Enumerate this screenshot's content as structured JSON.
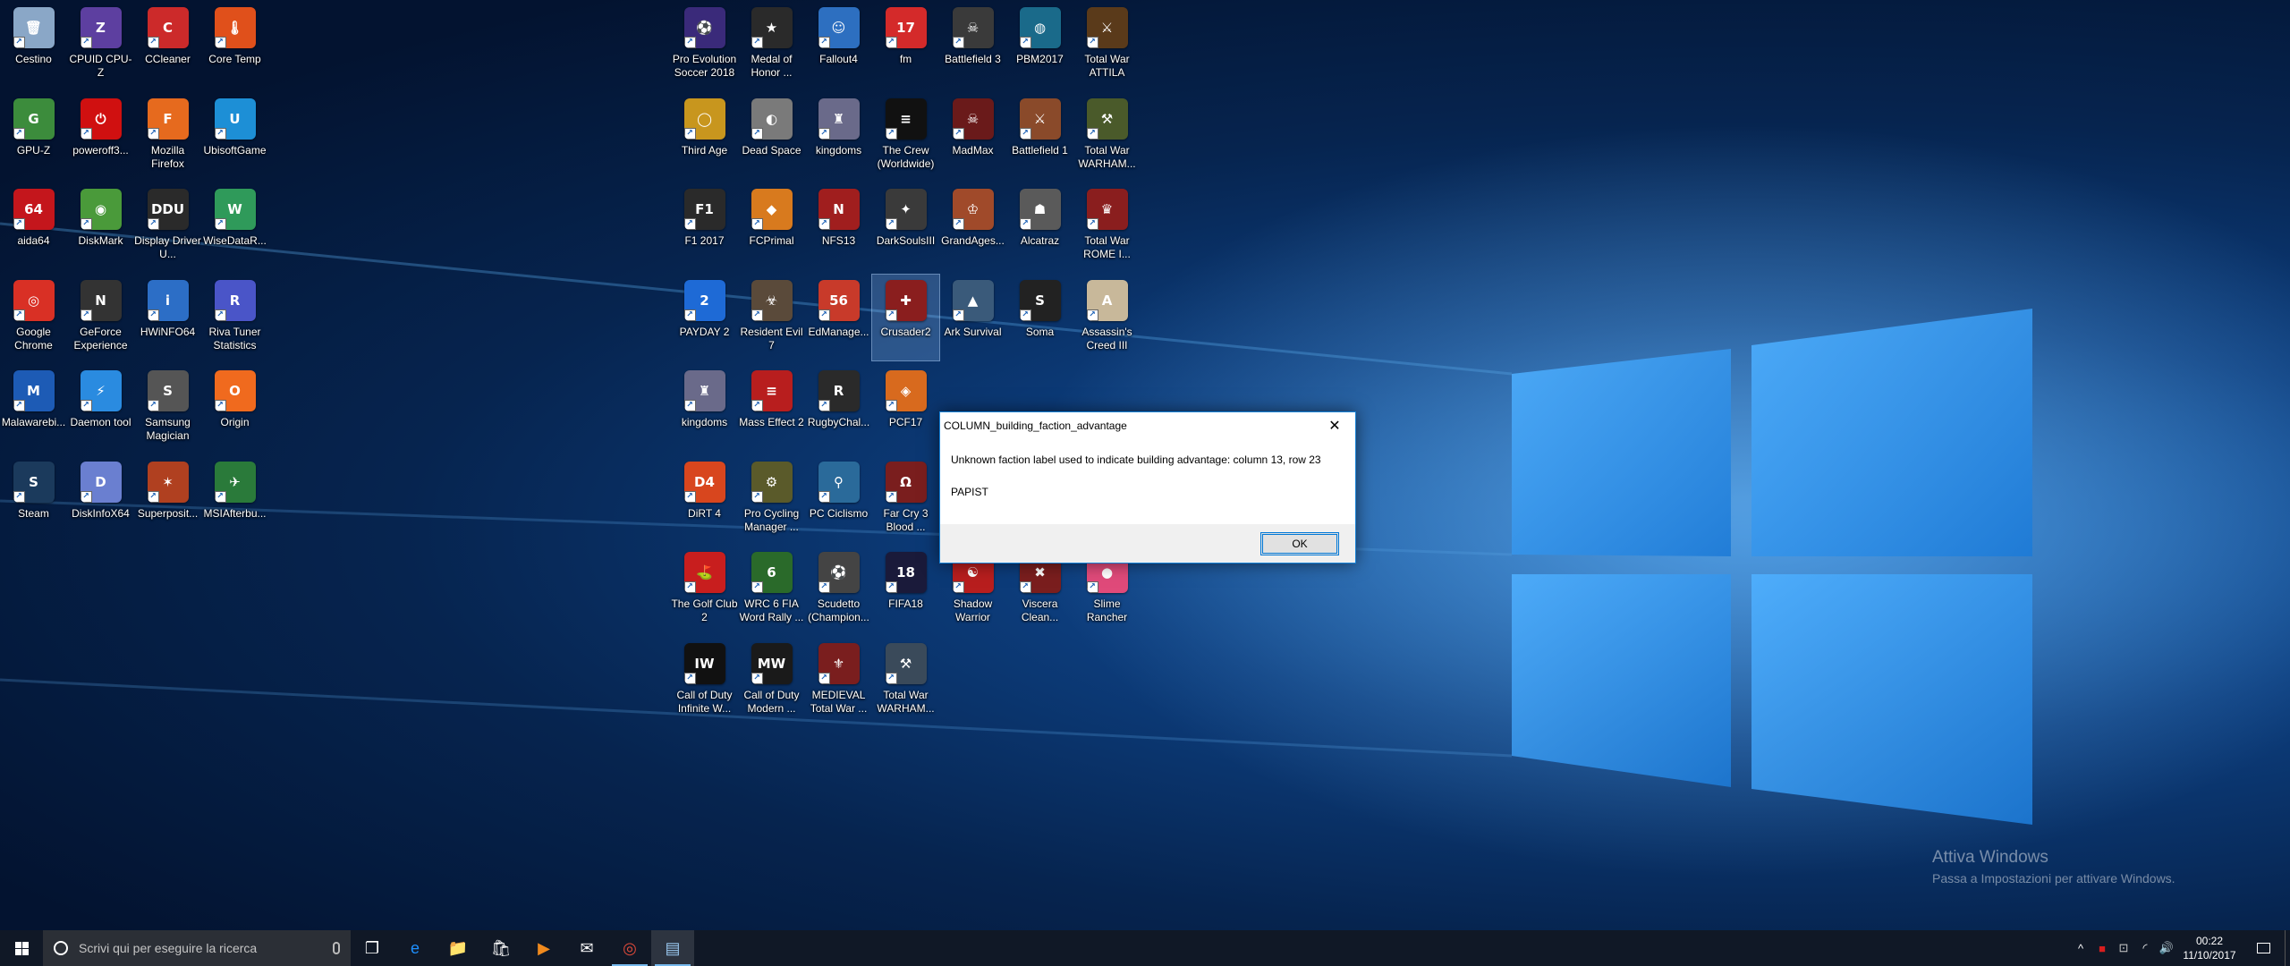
{
  "desktop_icons": [
    {
      "label": "Cestino",
      "icon": "recycle-bin-icon",
      "color": "#8aa7c7",
      "glyph": "🗑",
      "col": 0,
      "row": 0
    },
    {
      "label": "CPUID CPU-Z",
      "icon": "cpuz-icon",
      "color": "#5d3fa0",
      "glyph": "Z",
      "col": 1,
      "row": 0
    },
    {
      "label": "CCleaner",
      "icon": "ccleaner-icon",
      "color": "#cc2a2a",
      "glyph": "C",
      "col": 2,
      "row": 0
    },
    {
      "label": "Core Temp",
      "icon": "core-temp-icon",
      "color": "#e0501b",
      "glyph": "🌡",
      "col": 3,
      "row": 0
    },
    {
      "label": "GPU-Z",
      "icon": "gpuz-icon",
      "color": "#3c8c3c",
      "glyph": "G",
      "col": 0,
      "row": 1
    },
    {
      "label": "poweroff3...",
      "icon": "poweroff-icon",
      "color": "#d01010",
      "glyph": "⏻",
      "col": 1,
      "row": 1
    },
    {
      "label": "Mozilla Firefox",
      "icon": "firefox-icon",
      "color": "#e66a1e",
      "glyph": "F",
      "col": 2,
      "row": 1
    },
    {
      "label": "UbisoftGame",
      "icon": "ubisoft-icon",
      "color": "#1d8fd6",
      "glyph": "U",
      "col": 3,
      "row": 1
    },
    {
      "label": "aida64",
      "icon": "aida64-icon",
      "color": "#c4161c",
      "glyph": "64",
      "col": 0,
      "row": 2
    },
    {
      "label": "DiskMark",
      "icon": "diskmark-icon",
      "color": "#4a9a3a",
      "glyph": "◉",
      "col": 1,
      "row": 2
    },
    {
      "label": "Display Driver U...",
      "icon": "ddu-icon",
      "color": "#2a2a2a",
      "glyph": "DDU",
      "col": 2,
      "row": 2
    },
    {
      "label": "WiseDataR...",
      "icon": "wisedata-icon",
      "color": "#2f9a5a",
      "glyph": "W",
      "col": 3,
      "row": 2
    },
    {
      "label": "Google Chrome",
      "icon": "chrome-icon",
      "color": "#d93025",
      "glyph": "◎",
      "col": 0,
      "row": 3
    },
    {
      "label": "GeForce Experience",
      "icon": "geforce-icon",
      "color": "#333333",
      "glyph": "N",
      "col": 1,
      "row": 3
    },
    {
      "label": "HWiNFO64",
      "icon": "hwinfo-icon",
      "color": "#2c6ec6",
      "glyph": "i",
      "col": 2,
      "row": 3
    },
    {
      "label": "Riva Tuner Statistics",
      "icon": "rivatuner-icon",
      "color": "#4a55c8",
      "glyph": "R",
      "col": 3,
      "row": 3
    },
    {
      "label": "Malawarebi...",
      "icon": "malwarebytes-icon",
      "color": "#1d5bb5",
      "glyph": "M",
      "col": 0,
      "row": 4
    },
    {
      "label": "Daemon tool",
      "icon": "daemon-tools-icon",
      "color": "#2a8be0",
      "glyph": "⚡",
      "col": 1,
      "row": 4
    },
    {
      "label": "Samsung Magician",
      "icon": "samsung-magician-icon",
      "color": "#555555",
      "glyph": "S",
      "col": 2,
      "row": 4
    },
    {
      "label": "Origin",
      "icon": "origin-icon",
      "color": "#f06a1e",
      "glyph": "O",
      "col": 3,
      "row": 4
    },
    {
      "label": "Steam",
      "icon": "steam-icon",
      "color": "#1b3a5c",
      "glyph": "S",
      "col": 0,
      "row": 5
    },
    {
      "label": "DiskInfoX64",
      "icon": "diskinfo-icon",
      "color": "#6a7fd0",
      "glyph": "D",
      "col": 1,
      "row": 5
    },
    {
      "label": "Superposit...",
      "icon": "superposition-icon",
      "color": "#b04020",
      "glyph": "✶",
      "col": 2,
      "row": 5
    },
    {
      "label": "MSIAfterbu...",
      "icon": "msi-afterburner-icon",
      "color": "#2a7a3a",
      "glyph": "✈",
      "col": 3,
      "row": 5
    },
    {
      "label": "Pro Evolution Soccer 2018",
      "icon": "pes2018-icon",
      "color": "#3a2a7a",
      "glyph": "⚽",
      "col": 10,
      "row": 0
    },
    {
      "label": "Medal of Honor ...",
      "icon": "medal-of-honor-icon",
      "color": "#2a2a2a",
      "glyph": "★",
      "col": 11,
      "row": 0
    },
    {
      "label": "Fallout4",
      "icon": "fallout4-icon",
      "color": "#2d6fc0",
      "glyph": "☺",
      "col": 12,
      "row": 0
    },
    {
      "label": "fm",
      "icon": "football-manager-icon",
      "color": "#d42a2a",
      "glyph": "17",
      "col": 13,
      "row": 0
    },
    {
      "label": "Battlefield 3",
      "icon": "battlefield3-icon",
      "color": "#3a3a3a",
      "glyph": "☠",
      "col": 14,
      "row": 0
    },
    {
      "label": "PBM2017",
      "icon": "pbm2017-icon",
      "color": "#1a6a8a",
      "glyph": "◍",
      "col": 15,
      "row": 0
    },
    {
      "label": "Total War ATTILA",
      "icon": "attila-icon",
      "color": "#5a3a1a",
      "glyph": "⚔",
      "col": 16,
      "row": 0
    },
    {
      "label": "Third Age",
      "icon": "third-age-icon",
      "color": "#c8961e",
      "glyph": "◯",
      "col": 10,
      "row": 1
    },
    {
      "label": "Dead Space",
      "icon": "dead-space-icon",
      "color": "#7a7a7a",
      "glyph": "◐",
      "col": 11,
      "row": 1
    },
    {
      "label": "kingdoms",
      "icon": "kingdoms-icon",
      "color": "#6a6a8a",
      "glyph": "♜",
      "col": 12,
      "row": 1
    },
    {
      "label": "The Crew (Worldwide)",
      "icon": "the-crew-icon",
      "color": "#111111",
      "glyph": "≡",
      "col": 13,
      "row": 1
    },
    {
      "label": "MadMax",
      "icon": "madmax-icon",
      "color": "#6a1a1a",
      "glyph": "☠",
      "col": 14,
      "row": 1
    },
    {
      "label": "Battlefield 1",
      "icon": "battlefield1-icon",
      "color": "#8a4a2a",
      "glyph": "⚔",
      "col": 15,
      "row": 1
    },
    {
      "label": "Total War WARHAM...",
      "icon": "warhammer-icon",
      "color": "#4a5a2a",
      "glyph": "⚒",
      "col": 16,
      "row": 1
    },
    {
      "label": "F1 2017",
      "icon": "f1-2017-icon",
      "color": "#2a2a2a",
      "glyph": "F1",
      "col": 10,
      "row": 2
    },
    {
      "label": "FCPrimal",
      "icon": "fc-primal-icon",
      "color": "#d87a1e",
      "glyph": "◆",
      "col": 11,
      "row": 2
    },
    {
      "label": "NFS13",
      "icon": "nfs13-icon",
      "color": "#a01e1e",
      "glyph": "N",
      "col": 12,
      "row": 2
    },
    {
      "label": "DarkSoulsIII",
      "icon": "dark-souls-icon",
      "color": "#3a3a3a",
      "glyph": "✦",
      "col": 13,
      "row": 2
    },
    {
      "label": "GrandAges...",
      "icon": "grand-ages-icon",
      "color": "#a04a2a",
      "glyph": "♔",
      "col": 14,
      "row": 2
    },
    {
      "label": "Alcatraz",
      "icon": "alcatraz-icon",
      "color": "#5a5a5a",
      "glyph": "☗",
      "col": 15,
      "row": 2
    },
    {
      "label": "Total War ROME I...",
      "icon": "rome-icon",
      "color": "#8a1e1e",
      "glyph": "♛",
      "col": 16,
      "row": 2
    },
    {
      "label": "PAYDAY 2",
      "icon": "payday2-icon",
      "color": "#1e6ad6",
      "glyph": "2",
      "col": 10,
      "row": 3
    },
    {
      "label": "Resident Evil 7",
      "icon": "resident-evil-icon",
      "color": "#5a4a3a",
      "glyph": "☣",
      "col": 11,
      "row": 3
    },
    {
      "label": "EdManage...",
      "icon": "edmanager-icon",
      "color": "#c83a2a",
      "glyph": "56",
      "col": 12,
      "row": 3
    },
    {
      "label": "Crusader2",
      "icon": "crusader2-icon",
      "color": "#8a1e1e",
      "glyph": "✚",
      "col": 13,
      "row": 3,
      "selected": true
    },
    {
      "label": "Ark Survival",
      "icon": "ark-icon",
      "color": "#3a5a7a",
      "glyph": "▲",
      "col": 14,
      "row": 3
    },
    {
      "label": "Soma",
      "icon": "soma-icon",
      "color": "#222222",
      "glyph": "S",
      "col": 15,
      "row": 3
    },
    {
      "label": "Assassin's Creed III",
      "icon": "assassins-creed-icon",
      "color": "#c8b89a",
      "glyph": "A",
      "col": 16,
      "row": 3
    },
    {
      "label": "kingdoms",
      "icon": "kingdoms-icon",
      "color": "#6a6a8a",
      "glyph": "♜",
      "col": 10,
      "row": 4
    },
    {
      "label": "Mass Effect 2",
      "icon": "mass-effect-icon",
      "color": "#b81e1e",
      "glyph": "≡",
      "col": 11,
      "row": 4
    },
    {
      "label": "RugbyChal...",
      "icon": "rugby-challenge-icon",
      "color": "#2a2a2a",
      "glyph": "R",
      "col": 12,
      "row": 4
    },
    {
      "label": "PCF17",
      "icon": "pcf17-icon",
      "color": "#d86a1e",
      "glyph": "◈",
      "col": 13,
      "row": 4
    },
    {
      "label": "DiRT 4",
      "icon": "dirt4-icon",
      "color": "#d8461e",
      "glyph": "D4",
      "col": 10,
      "row": 5
    },
    {
      "label": "Pro Cycling Manager ...",
      "icon": "pro-cycling-icon",
      "color": "#5a5a2a",
      "glyph": "⚙",
      "col": 11,
      "row": 5
    },
    {
      "label": "PC Ciclismo",
      "icon": "pc-ciclismo-icon",
      "color": "#2a6a9a",
      "glyph": "⚲",
      "col": 12,
      "row": 5
    },
    {
      "label": "Far Cry 3 Blood ...",
      "icon": "far-cry-icon",
      "color": "#7a1e1e",
      "glyph": "Ω",
      "col": 13,
      "row": 5
    },
    {
      "label": "The Golf Club 2",
      "icon": "golf-club-icon",
      "color": "#c81e1e",
      "glyph": "⛳",
      "col": 10,
      "row": 6
    },
    {
      "label": "WRC 6 FIA Word Rally ...",
      "icon": "wrc6-icon",
      "color": "#2a6a2a",
      "glyph": "6",
      "col": 11,
      "row": 6
    },
    {
      "label": "Scudetto (Champion...",
      "icon": "scudetto-icon",
      "color": "#444444",
      "glyph": "⚽",
      "col": 12,
      "row": 6
    },
    {
      "label": "FIFA18",
      "icon": "fifa18-icon",
      "color": "#1a1a3a",
      "glyph": "18",
      "col": 13,
      "row": 6
    },
    {
      "label": "Call of Duty Infinite W...",
      "icon": "cod-infinite-warfare-icon",
      "color": "#111111",
      "glyph": "IW",
      "col": 10,
      "row": 7
    },
    {
      "label": "Call of Duty Modern ...",
      "icon": "cod-modern-warfare-icon",
      "color": "#1a1a1a",
      "glyph": "MW",
      "col": 11,
      "row": 7
    },
    {
      "label": "MEDIEVAL Total War ...",
      "icon": "medieval-icon",
      "color": "#7a1e1e",
      "glyph": "⚜",
      "col": 12,
      "row": 7
    },
    {
      "label": "Total War WARHAM...",
      "icon": "warhammer2-icon",
      "color": "#3a4a5a",
      "glyph": "⚒",
      "col": 13,
      "row": 7
    }
  ],
  "hidden_icons": [
    {
      "label": "Shadow Warrior",
      "icon": "shadow-warrior-icon",
      "color": "#b81e1e",
      "glyph": "☯",
      "col": 14,
      "row": 6
    },
    {
      "label": "Viscera Clean...",
      "icon": "viscera-icon",
      "color": "#7a1e1e",
      "glyph": "✖",
      "col": 15,
      "row": 6
    },
    {
      "label": "Slime Rancher",
      "icon": "slime-rancher-icon",
      "color": "#e04a7a",
      "glyph": "●",
      "col": 16,
      "row": 6
    }
  ],
  "dialog": {
    "title": "COLUMN_building_faction_advantage",
    "message": "Unknown faction label used to indicate building advantage: column 13, row 23",
    "detail": "PAPIST",
    "ok_label": "OK",
    "close_glyph": "✕"
  },
  "watermark": {
    "title": "Attiva Windows",
    "subtitle": "Passa a Impostazioni per attivare Windows."
  },
  "taskbar": {
    "search_placeholder": "Scrivi qui per eseguire la ricerca",
    "apps": [
      {
        "icon": "task-view-icon",
        "glyph": "❐",
        "active": false,
        "current": false
      },
      {
        "icon": "edge-icon",
        "glyph": "e",
        "color": "#1e90ff",
        "active": false,
        "current": false
      },
      {
        "icon": "file-explorer-icon",
        "glyph": "📁",
        "active": false,
        "current": false
      },
      {
        "icon": "store-icon",
        "glyph": "🛍",
        "active": false,
        "current": false
      },
      {
        "icon": "media-player-icon",
        "glyph": "▶",
        "color": "#f08a1e",
        "active": false,
        "current": false
      },
      {
        "icon": "mail-icon",
        "glyph": "✉",
        "active": false,
        "current": false
      },
      {
        "icon": "chrome-taskbar-icon",
        "glyph": "◎",
        "color": "#e04a3a",
        "active": true,
        "current": false
      },
      {
        "icon": "app-window-icon",
        "glyph": "▤",
        "color": "#9ac8f0",
        "active": true,
        "current": true
      }
    ],
    "tray": {
      "chevron": "^",
      "icons": [
        {
          "name": "antivirus-tray-icon",
          "glyph": "■",
          "color": "#d81e1e"
        },
        {
          "name": "security-tray-icon",
          "glyph": "⊡",
          "color": "#cccccc"
        },
        {
          "name": "network-tray-icon",
          "glyph": "◜",
          "color": "#ffffff"
        },
        {
          "name": "volume-tray-icon",
          "glyph": "🔊",
          "color": "#ffffff"
        }
      ],
      "time": "00:22",
      "date": "11/10/2017"
    }
  }
}
